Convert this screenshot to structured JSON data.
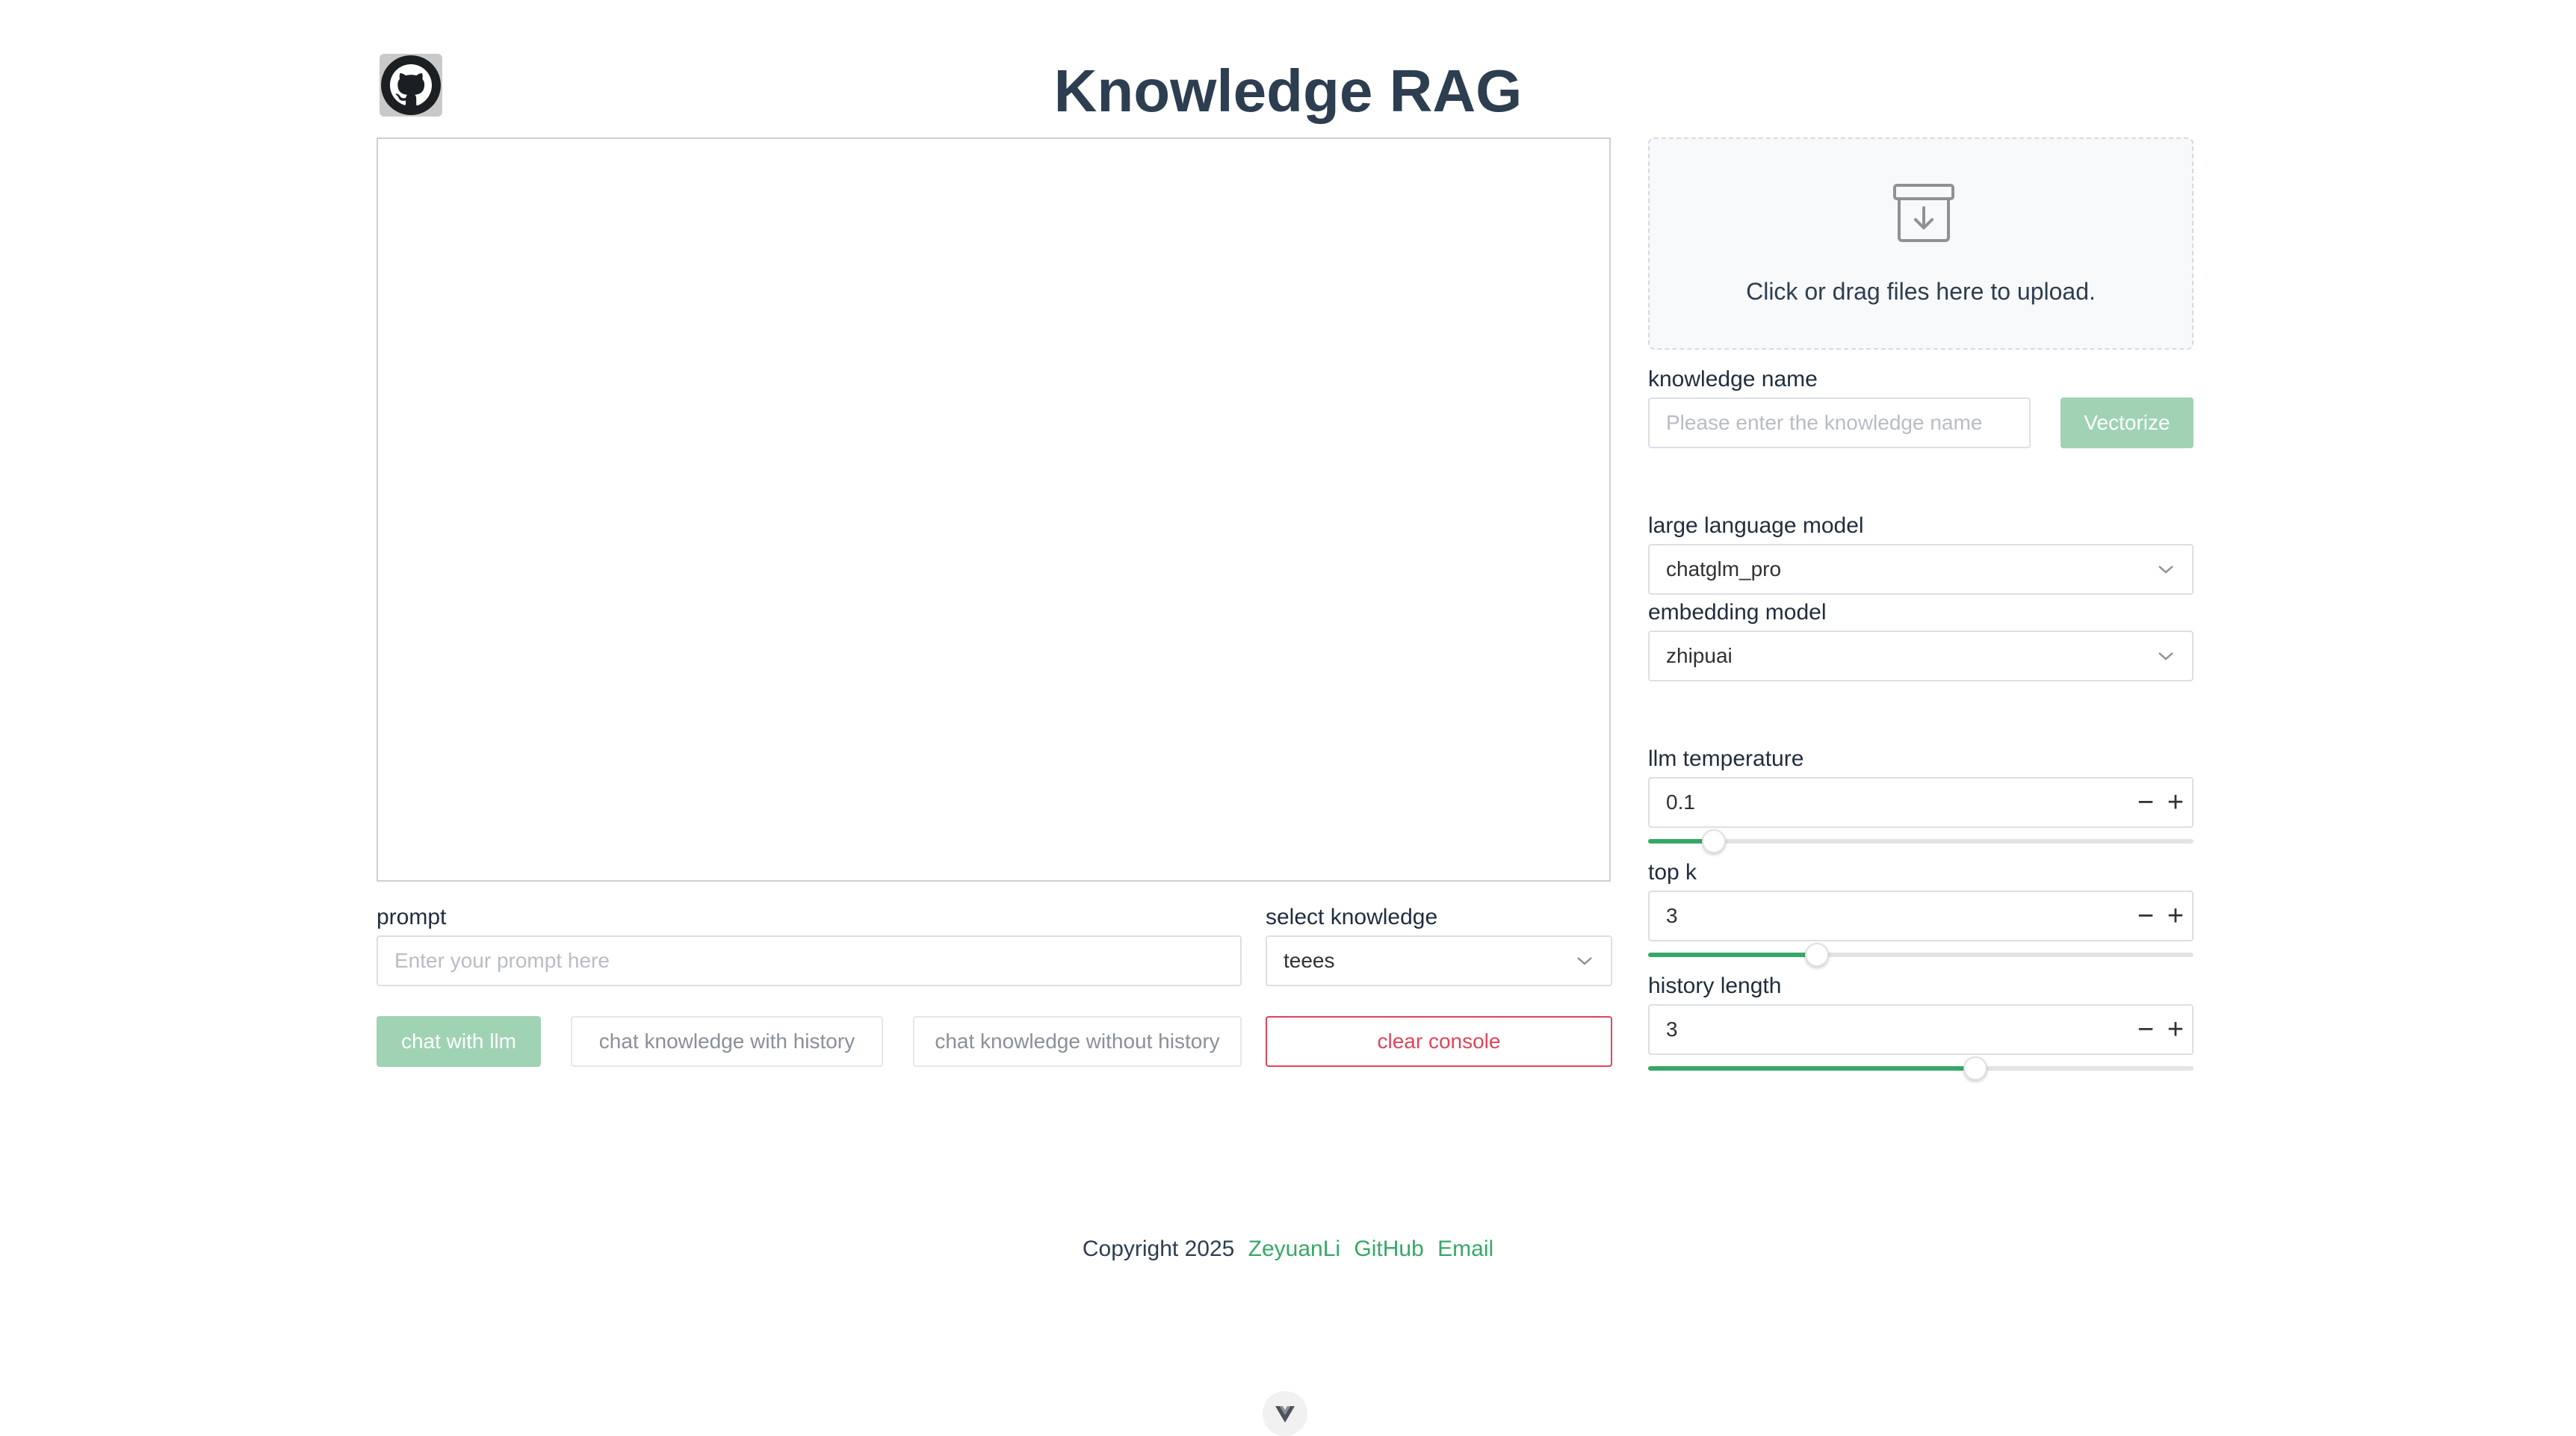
{
  "header": {
    "title": "Knowledge RAG",
    "github_icon": "github-icon"
  },
  "chat": {
    "prompt_label": "prompt",
    "prompt_placeholder": "Enter your prompt here",
    "prompt_value": "",
    "select_knowledge_label": "select knowledge",
    "select_knowledge_value": "teees",
    "buttons": {
      "chat_llm": "chat with llm",
      "chat_with_history": "chat knowledge with history",
      "chat_without_history": "chat knowledge without history",
      "clear_console": "clear console"
    }
  },
  "upload": {
    "icon": "archive-download-icon",
    "text": "Click or drag files here to upload."
  },
  "knowledge": {
    "name_label": "knowledge name",
    "name_placeholder": "Please enter the knowledge name",
    "vectorize_label": "Vectorize"
  },
  "models": {
    "llm_label": "large language model",
    "llm_value": "chatglm_pro",
    "embedding_label": "embedding model",
    "embedding_value": "zhipuai"
  },
  "params": {
    "temperature": {
      "label": "llm temperature",
      "value": "0.1",
      "slider_fraction": 0.12
    },
    "top_k": {
      "label": "top k",
      "value": "3",
      "slider_fraction": 0.31
    },
    "history_length": {
      "label": "history length",
      "value": "3",
      "slider_fraction": 0.6
    }
  },
  "footer": {
    "copyright": "Copyright 2025",
    "author": "ZeyuanLi",
    "github": "GitHub",
    "email": "Email"
  },
  "colors": {
    "accent": "#36a866",
    "accent_light": "#9fd3b3",
    "danger": "#e0455a",
    "text": "#2c3e50"
  }
}
